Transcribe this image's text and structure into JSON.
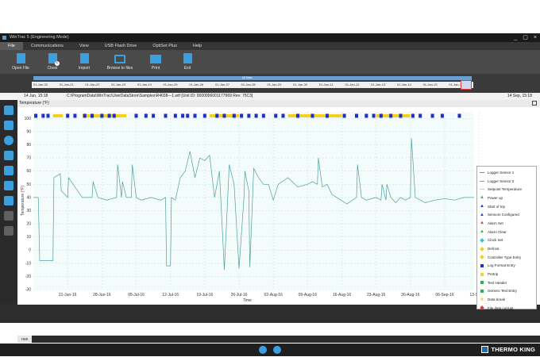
{
  "window": {
    "title": "WinTrac 5 (Engineering Mode)",
    "controls": [
      "_",
      "▢",
      "×"
    ]
  },
  "menu": {
    "tabs": [
      "File",
      "Communications",
      "View",
      "USB Flash Drive",
      "OptiSet Plus",
      "Help"
    ]
  },
  "ribbon": {
    "buttons": [
      {
        "label": "Open File",
        "icon": "open-file-icon"
      },
      {
        "label": "Close",
        "icon": "close-file-icon"
      },
      {
        "label": "Import",
        "icon": "import-icon"
      },
      {
        "label": "Browse to files",
        "icon": "folder-icon"
      },
      {
        "label": "Print",
        "icon": "printer-icon"
      },
      {
        "label": "Exit",
        "icon": "exit-icon"
      }
    ]
  },
  "timeline": {
    "ticks": [
      "01-Jan-20",
      "01-Jan-21",
      "01-Jan-22",
      "01-Jan-23",
      "01-Jan-24",
      "01-Jan-25",
      "01-Jan-26",
      "01-Jan-27",
      "01-Jan-28",
      "01-Jan-29",
      "01-Jan-30",
      "01-Jan-11",
      "01-Jan-12",
      "01-Jan-13",
      "01-Jan-14",
      "01-Jan-15",
      "01-Jan-16"
    ],
    "range_label": "All Data"
  },
  "info": {
    "start": "14 Jun, 15:18",
    "path": "C:\\ProgramData\\WinTrac\\UserDataStore\\Samples\\R4038—1.wtf",
    "unit": "[Unit ID: 0000006001177969   Rev: 75C3]",
    "end": "14 Sep, 15:18"
  },
  "chart_header": "Temperature (°F)",
  "chart_data": {
    "type": "line",
    "xlabel": "Time",
    "ylabel": "Temperature (°F)",
    "ylim": [
      -30,
      105
    ],
    "yticks": [
      -30,
      -20,
      -10,
      0,
      10,
      20,
      30,
      40,
      50,
      60,
      70,
      80,
      90,
      100
    ],
    "xlim": [
      0,
      90
    ],
    "xtick_labels": [
      "21-Jun-16",
      "28-Jun-16",
      "05-Jul-16",
      "12-Jul-16",
      "19-Jul-16",
      "26-Jul-16",
      "02-Aug-16",
      "09-Aug-16",
      "16-Aug-16",
      "23-Aug-16",
      "30-Aug-16",
      "06-Sep-16",
      "13-Sep-16"
    ],
    "xtick_days": [
      7,
      14,
      21,
      28,
      35,
      42,
      49,
      56,
      63,
      70,
      77,
      84,
      91
    ],
    "grid": true,
    "series": [
      {
        "name": "Logger Sensor 1",
        "color": "#4f9e9e",
        "x": [
          0,
          1,
          1.3,
          2,
          4,
          4.2,
          5.5,
          5.7,
          6.5,
          7,
          7.2,
          10,
          12,
          12.2,
          13,
          13.2,
          14,
          15,
          17,
          17.2,
          18,
          18.2,
          19,
          20,
          20.2,
          21,
          22,
          24,
          26,
          27,
          27.2,
          28,
          28.2,
          29,
          30,
          31,
          32,
          33,
          34,
          35,
          36,
          37,
          38,
          39,
          40,
          41,
          42,
          43,
          43.2,
          44,
          44.2,
          45,
          46,
          47,
          48,
          49,
          50,
          52,
          54,
          56,
          57,
          58,
          58.2,
          59,
          60,
          61,
          62,
          64,
          66,
          66.2,
          67,
          68,
          70,
          71,
          71.2,
          72,
          72.2,
          73,
          74,
          75,
          76,
          77,
          77.2,
          78,
          79,
          80,
          82,
          84,
          86,
          88,
          90
        ],
        "y": [
          40,
          40,
          -8,
          -8,
          -8,
          55,
          58,
          45,
          42,
          40,
          55,
          40,
          40,
          52,
          42,
          40,
          39,
          38,
          40,
          65,
          40,
          52,
          40,
          40,
          65,
          40,
          38,
          40,
          38,
          40,
          -12,
          -12,
          40,
          38,
          55,
          60,
          75,
          55,
          70,
          68,
          72,
          40,
          60,
          -15,
          65,
          50,
          -14,
          40,
          60,
          45,
          -13,
          62,
          55,
          50,
          50,
          38,
          50,
          55,
          48,
          50,
          52,
          50,
          70,
          48,
          50,
          42,
          40,
          35,
          40,
          65,
          40,
          38,
          40,
          38,
          50,
          38,
          50,
          40,
          36,
          40,
          38,
          40,
          85,
          40,
          38,
          36,
          38,
          39,
          38,
          40,
          40
        ]
      },
      {
        "name": "Logger Sensor 2",
        "color": "#9a9a9a",
        "x": [],
        "y": []
      },
      {
        "name": "Setpoint Temperature",
        "color": "#c8c8c8",
        "x": [],
        "y": []
      }
    ],
    "event_strip": {
      "y": 102,
      "yellow_segments": [
        [
          4,
          6
        ],
        [
          10,
          19
        ],
        [
          36,
          42
        ],
        [
          52,
          63
        ],
        [
          70,
          77
        ]
      ],
      "blue_markers": [
        0.5,
        2,
        3,
        7,
        8.5,
        10.5,
        12,
        14,
        15.5,
        16.5,
        21,
        23,
        24.5,
        27,
        29,
        30.5,
        31.5,
        33,
        35,
        37.5,
        39,
        41,
        42.5,
        44,
        45.5,
        47,
        49.5,
        51,
        54,
        57,
        60,
        63.5,
        66,
        68,
        69.5,
        71,
        73,
        75,
        77.5,
        79,
        81.5,
        83.5,
        87
      ]
    }
  },
  "legend": [
    {
      "label": "Logger Sensor 1",
      "shape": "line",
      "color": "#4f9e9e"
    },
    {
      "label": "Logger Sensor 2",
      "shape": "line",
      "color": "#9a9a9a"
    },
    {
      "label": "Setpoint Temperature",
      "shape": "line",
      "color": "#c8c8c8"
    },
    {
      "label": "Power up",
      "shape": "triangle",
      "color": "#2bb24c"
    },
    {
      "label": "Start of trip",
      "shape": "triangle",
      "color": "#1f3fb5"
    },
    {
      "label": "Sensors Configured",
      "shape": "triangle",
      "color": "#1f3fb5"
    },
    {
      "label": "Alarm Set",
      "shape": "triangle",
      "color": "#d43b3b"
    },
    {
      "label": "Alarm Clear",
      "shape": "triangle",
      "color": "#2bb24c"
    },
    {
      "label": "Clock Set",
      "shape": "diamond",
      "color": "#29c6d6"
    },
    {
      "label": "Defrost",
      "shape": "diamond",
      "color": "#f2d21b"
    },
    {
      "label": "Controller Type Entry",
      "shape": "diamond",
      "color": "#f2d21b"
    },
    {
      "label": "Log Format Entry",
      "shape": "square",
      "color": "#1f2fc4"
    },
    {
      "label": "Pretrip",
      "shape": "square",
      "color": "#f2d21b"
    },
    {
      "label": "Text Header",
      "shape": "square",
      "color": "#2bb24c"
    },
    {
      "label": "Generic Text Entry",
      "shape": "square",
      "color": "#2bb24c"
    },
    {
      "label": "Data break",
      "shape": "star",
      "color": "#f2d21b"
    },
    {
      "label": "File data corrupt",
      "shape": "diamond",
      "color": "#d43b3b"
    }
  ],
  "bottom_tab": "HMI",
  "brand": "THERMO KING"
}
